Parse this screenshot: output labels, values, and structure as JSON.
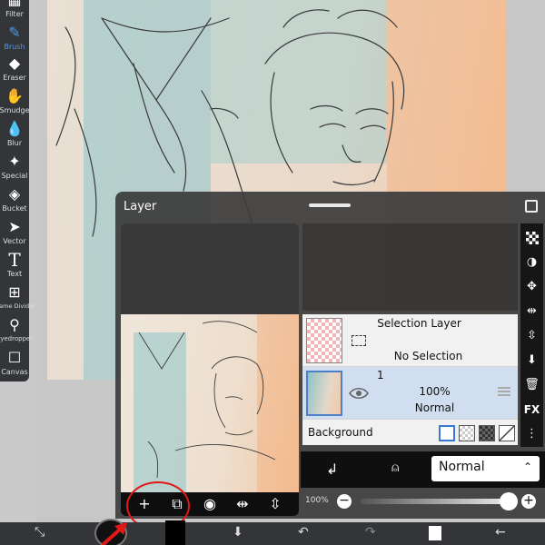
{
  "toolbar": {
    "tools": [
      {
        "label": "Filter",
        "icon": "filter-icon"
      },
      {
        "label": "Brush",
        "icon": "brush-icon",
        "active": true
      },
      {
        "label": "Eraser",
        "icon": "eraser-icon"
      },
      {
        "label": "Smudge",
        "icon": "smudge-icon"
      },
      {
        "label": "Blur",
        "icon": "blur-icon"
      },
      {
        "label": "Special",
        "icon": "special-icon"
      },
      {
        "label": "Bucket",
        "icon": "bucket-icon"
      },
      {
        "label": "Vector",
        "icon": "vector-icon"
      },
      {
        "label": "Text",
        "icon": "text-icon"
      },
      {
        "label": "Frame Divider",
        "icon": "frame-divider-icon"
      },
      {
        "label": "Eyedropper",
        "icon": "eyedropper-icon"
      },
      {
        "label": "Canvas",
        "icon": "canvas-icon"
      }
    ],
    "accent": "#4d9ae8"
  },
  "layer_panel": {
    "title": "Layer",
    "selection_layer": {
      "title": "Selection Layer",
      "status": "No Selection"
    },
    "layer1": {
      "number": "1",
      "opacity": "100%",
      "blend": "Normal"
    },
    "background": {
      "label": "Background"
    },
    "blend_mode": "Normal",
    "opacity_label": "100%",
    "opacity_value": 1.0
  },
  "colors": {
    "panel": "#3c3c3c",
    "selected_row": "#d1deef",
    "highlight_circle": "#e01818"
  }
}
